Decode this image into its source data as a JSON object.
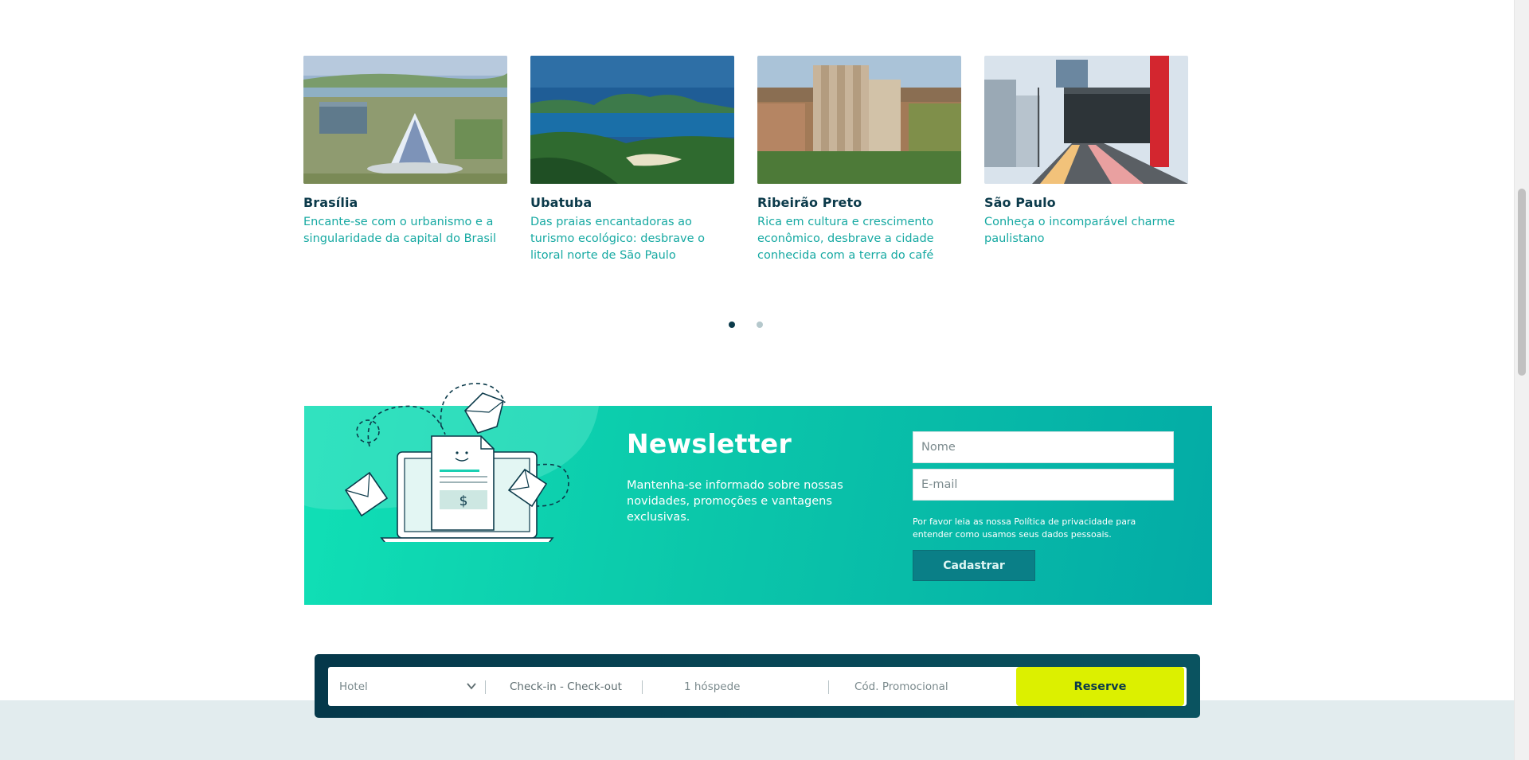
{
  "destinations": [
    {
      "title": "Brasília",
      "description": "Encante-se com o urbanismo e a singularidade da capital do Brasil"
    },
    {
      "title": "Ubatuba",
      "description": "Das praias encantadoras ao turismo ecológico: desbrave o litoral norte de São Paulo"
    },
    {
      "title": "Ribeirão Preto",
      "description": "Rica em cultura e crescimento econômico, desbrave a cidade conhecida com a terra do café"
    },
    {
      "title": "São Paulo",
      "description": "Conheça o incomparável charme paulistano"
    }
  ],
  "carousel": {
    "pages": 2,
    "active_page": 1
  },
  "newsletter": {
    "title": "Newsletter",
    "text": "Mantenha-se informado sobre nossas novidades, promoções e vantagens exclusivas.",
    "name_placeholder": "Nome",
    "email_placeholder": "E-mail",
    "privacy_text": "Por favor leia as nossa Política de privacidade para entender como usamos seus dados pessoais.",
    "button_label": "Cadastrar",
    "illustration_symbol": "$"
  },
  "booking": {
    "hotel_placeholder": "Hotel",
    "dates_label": "Check-in - Check-out",
    "guests_label": "1 hóspede",
    "promo_label": "Cód. Promocional",
    "reserve_label": "Reserve"
  },
  "colors": {
    "brand_dark": "#0b3a4a",
    "teal_text": "#16a9a2",
    "newsletter_gradient_start": "#10e0b6",
    "newsletter_gradient_end": "#03aba6",
    "reserve_accent": "#dcf000"
  },
  "icons": [
    "chevron-down-icon",
    "envelope-icon",
    "laptop-icon",
    "dollar-document-icon"
  ]
}
